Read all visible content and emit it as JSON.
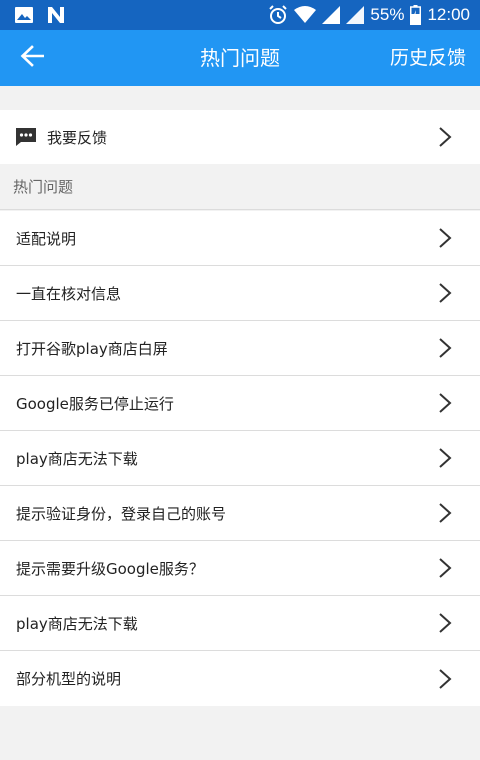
{
  "status_bar": {
    "battery": "55%",
    "time": "12:00",
    "icons": [
      "image-icon",
      "n-logo-icon",
      "alarm-icon",
      "wifi-icon",
      "signal-icon",
      "signal-icon",
      "battery-icon"
    ]
  },
  "app_bar": {
    "back_icon": "arrow-left-icon",
    "title": "热门问题",
    "action_label": "历史反馈"
  },
  "feedback_entry": {
    "icon": "message-icon",
    "label": "我要反馈"
  },
  "faq": {
    "section_title": "热门问题",
    "items": [
      {
        "label": "适配说明"
      },
      {
        "label": "一直在核对信息"
      },
      {
        "label": "打开谷歌play商店白屏"
      },
      {
        "label": "Google服务已停止运行"
      },
      {
        "label": "play商店无法下载"
      },
      {
        "label": "提示验证身份，登录自己的账号"
      },
      {
        "label": "提示需要升级Google服务？"
      },
      {
        "label": "play商店无法下载"
      },
      {
        "label": "部分机型的说明"
      }
    ]
  },
  "colors": {
    "status_bar": "#1565c0",
    "app_bar": "#2196f3",
    "background": "#f2f2f2",
    "divider": "#dcdcdc"
  }
}
